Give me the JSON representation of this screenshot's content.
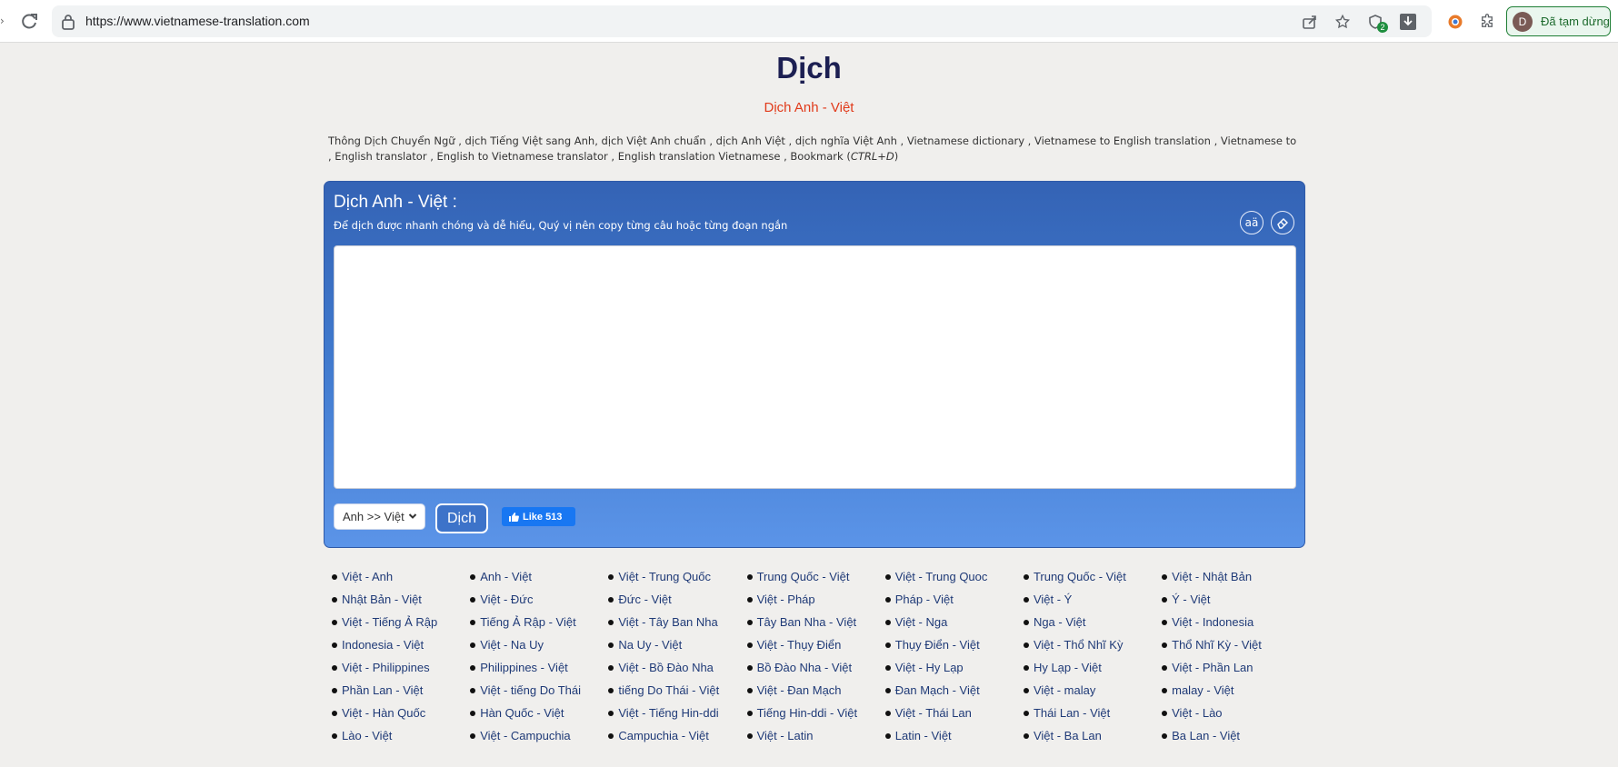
{
  "browser": {
    "url": "https://www.vietnamese-translation.com",
    "profile_label": "Đã tạm dừng",
    "profile_initial": "D",
    "extension_badge": "2",
    "icons": [
      "reload-icon",
      "lock-icon",
      "share-icon",
      "star-icon",
      "extension-check-icon",
      "download-icon",
      "chrome-ext-icon",
      "puzzle-icon"
    ]
  },
  "header": {
    "title": "Dịch",
    "subtitle": "Dịch Anh - Việt",
    "keywords": "Thông Dịch Chuyển Ngữ , dịch Tiếng Việt sang Anh, dịch Việt Anh chuẩn , dịch Anh Việt , dịch nghĩa Việt Anh , Vietnamese dictionary , Vietnamese to English translation , Vietnamese to , English translator , English to Vietnamese translator , English translation Vietnamese , Bookmark (",
    "bookmark_shortcut": "CTRL+D",
    "keywords_end": ")"
  },
  "panel": {
    "title": "Dịch Anh - Việt :",
    "hint": "Để dịch được nhanh chóng và dễ hiểu, Quý vị nên copy từng câu hoặc từng đoạn ngắn",
    "font_size_icon_label": "aä",
    "textarea_value": "",
    "selected_direction": "Anh >> Việt",
    "translate_label": "Dịch",
    "like_label": "Like 513",
    "colors": {
      "panel_top": "#3463b5",
      "panel_bottom": "#5b94e8",
      "title": "#1c1f52",
      "subtitle": "#e13a1a",
      "fb": "#1877f2"
    }
  },
  "links": [
    "Việt - Anh",
    "Anh - Việt",
    "Việt - Trung Quốc",
    "Trung Quốc - Việt",
    "Việt - Trung Quoc",
    "Trung Quốc - Việt",
    "Việt - Nhật Bản",
    "Nhật Bản - Việt",
    "Việt - Đức",
    "Đức - Việt",
    "Việt - Pháp",
    "Pháp - Việt",
    "Việt - Ý",
    "Ý - Việt",
    "Việt - Tiếng Ả Rập",
    "Tiếng Ả Rập - Việt",
    "Việt - Tây Ban Nha",
    "Tây Ban Nha - Việt",
    "Việt - Nga",
    "Nga - Việt",
    "Việt - Indonesia",
    "Indonesia - Việt",
    "Việt - Na Uy",
    "Na Uy - Việt",
    "Việt - Thụy Điển",
    "Thụy Điển - Việt",
    "Việt - Thổ Nhĩ Kỳ",
    "Thổ Nhĩ Kỳ - Việt",
    "Việt - Philippines",
    "Philippines - Việt",
    "Việt - Bồ Đào Nha",
    "Bồ Đào Nha - Việt",
    "Việt - Hy Lạp",
    "Hy Lạp - Việt",
    "Việt - Phần Lan",
    "Phần Lan - Việt",
    "Việt - tiếng Do Thái",
    "tiếng Do Thái - Việt",
    "Việt - Đan Mạch",
    "Đan Mạch - Việt",
    "Việt - malay",
    "malay - Việt",
    "Việt - Hàn Quốc",
    "Hàn Quốc - Việt",
    "Việt - Tiếng Hin-ddi",
    "Tiếng Hin-ddi - Việt",
    "Việt - Thái Lan",
    "Thái Lan - Việt",
    "Việt - Lào",
    "Lào - Việt",
    "Việt - Campuchia",
    "Campuchia - Việt",
    "Việt - Latin",
    "Latin - Việt",
    "Việt - Ba Lan",
    "Ba Lan - Việt"
  ]
}
